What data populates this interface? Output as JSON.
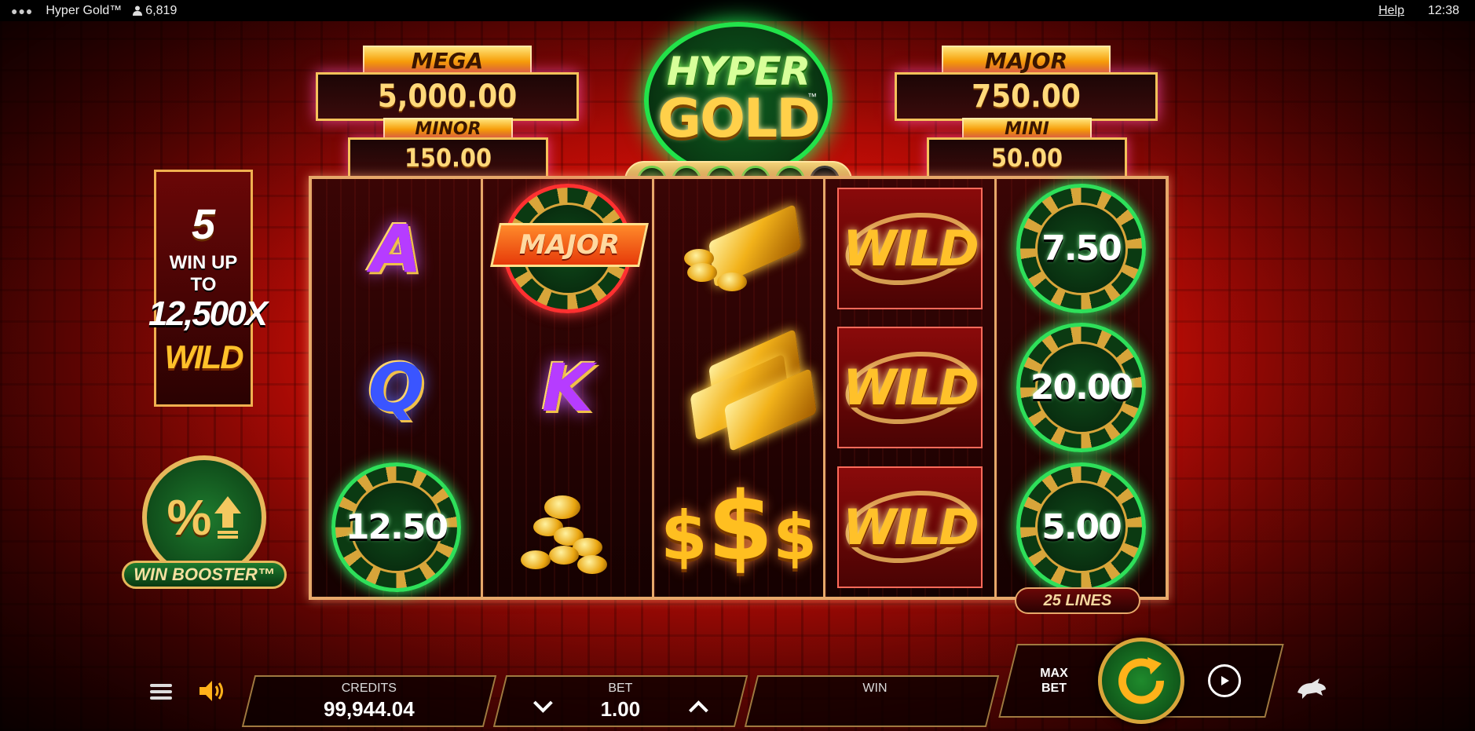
{
  "topbar": {
    "menu_dots": "●●●",
    "game_title": "Hyper Gold™",
    "player_count": "6,819",
    "help": "Help",
    "time": "12:38"
  },
  "jackpots": {
    "mega": {
      "label": "MEGA",
      "value": "5,000.00"
    },
    "minor": {
      "label": "MINOR",
      "value": "150.00"
    },
    "major": {
      "label": "MAJOR",
      "value": "750.00"
    },
    "mini": {
      "label": "MINI",
      "value": "50.00"
    }
  },
  "logo": {
    "line1": "HYPER",
    "line2": "GOLD",
    "tm": "™"
  },
  "progress_pips": {
    "filled": 5,
    "total": 6
  },
  "promo": {
    "count": "5",
    "line1": "WIN UP TO",
    "line2": "12,500X",
    "wild": "WILD"
  },
  "booster": {
    "symbol": "%",
    "label": "WIN BOOSTER™"
  },
  "reels": {
    "reel1": {
      "top": "A",
      "mid": "Q",
      "bottom_chip": "12.50"
    },
    "reel2": {
      "top_chip_banner": "MAJOR",
      "mid": "K"
    },
    "reel3": {
      "bottom": "$$$"
    },
    "reel4": {
      "wild": "WILD"
    },
    "reel5": {
      "chip_top": "7.50",
      "chip_mid": "20.00",
      "chip_bottom": "5.00"
    }
  },
  "lines": "25 LINES",
  "bottom": {
    "credits_label": "CREDITS",
    "credits_value": "99,944.04",
    "bet_label": "BET",
    "bet_value": "1.00",
    "win_label": "WIN",
    "win_value": "",
    "max_bet": "MAX BET"
  },
  "colors": {
    "accent_gold": "#f4c25a",
    "chip_green": "#2ee05a",
    "bg_red": "#c80d06"
  },
  "icons": [
    "menu-icon",
    "sound-icon",
    "user-icon",
    "spin-icon",
    "autoplay-icon",
    "turbo-icon",
    "chevron-down-icon",
    "chevron-up-icon"
  ]
}
